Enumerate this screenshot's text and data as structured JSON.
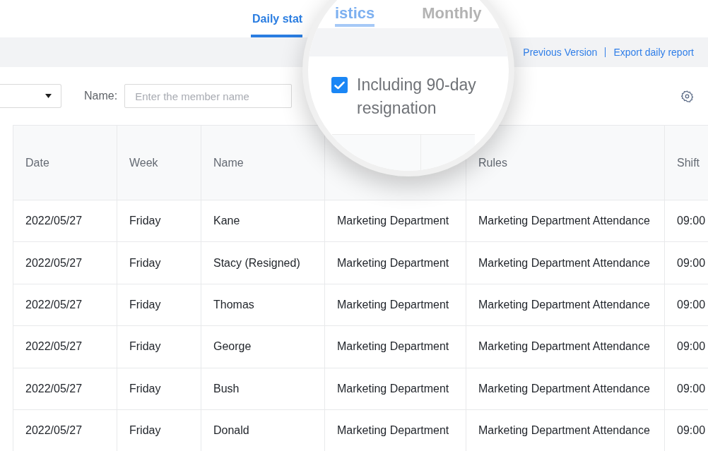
{
  "tabs": [
    {
      "label": "Daily stat",
      "selected": true
    }
  ],
  "toolbar": {
    "links": [
      "Previous Version",
      "Export daily report"
    ]
  },
  "filters": {
    "name_field": {
      "label": "Name:",
      "placeholder": "Enter the member name"
    }
  },
  "table": {
    "columns": [
      "Date",
      "Week",
      "Name",
      null,
      "Rules",
      "Shift"
    ],
    "rows": [
      [
        "2022/05/27",
        "Friday",
        "Kane",
        "Marketing Department",
        "Marketing Department Attendance",
        "09:00"
      ],
      [
        "2022/05/27",
        "Friday",
        "Stacy (Resigned)",
        "Marketing Department",
        "Marketing Department Attendance",
        "09:00"
      ],
      [
        "2022/05/27",
        "Friday",
        "Thomas",
        "Marketing Department",
        "Marketing Department Attendance",
        "09:00"
      ],
      [
        "2022/05/27",
        "Friday",
        "George",
        "Marketing Department",
        "Marketing Department Attendance",
        "09:00"
      ],
      [
        "2022/05/27",
        "Friday",
        "Bush",
        "Marketing Department",
        "Marketing Department Attendance",
        "09:00"
      ],
      [
        "2022/05/27",
        "Friday",
        "Donald",
        "Marketing Department",
        "Marketing Department Attendance",
        "09:00"
      ]
    ]
  },
  "magnifier": {
    "tabs": [
      {
        "label": "istics",
        "selected": true
      },
      {
        "label": "Monthly",
        "selected": false
      }
    ],
    "option": {
      "label": "Including 90-day resignation",
      "checked": true
    }
  }
}
